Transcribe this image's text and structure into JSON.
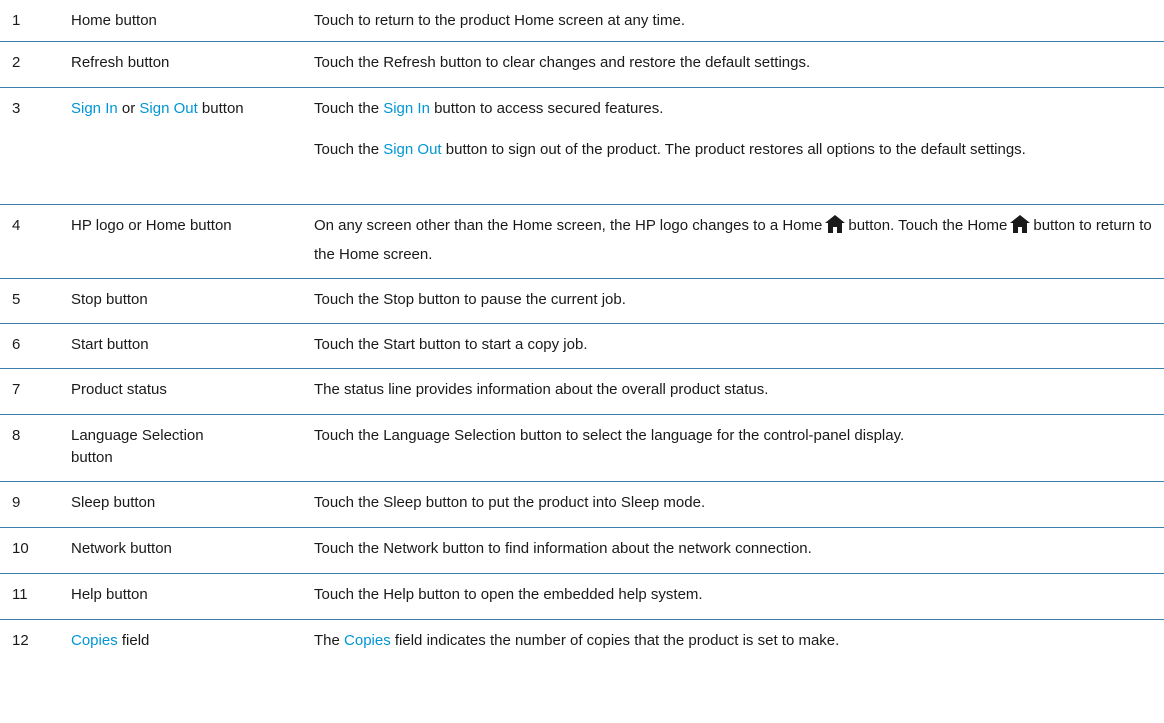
{
  "rows": [
    {
      "num": "1",
      "item": "Home button",
      "desc": "Touch to return to the product Home screen at any time."
    },
    {
      "num": "2",
      "item": "Refresh button",
      "desc": "Touch the Refresh button to clear changes and restore the default settings."
    },
    {
      "num": "3",
      "item_link_a": "Sign In",
      "item_or": " or ",
      "item_link_b": "Sign Out",
      "item_tail": " button",
      "desc1_pre": "Touch the ",
      "desc1_link": "Sign In",
      "desc1_post": " button to access secured features.",
      "desc2_pre": "Touch the ",
      "desc2_link": "Sign Out",
      "desc2_post": " button to sign out of the product. The product restores all options to the default settings."
    },
    {
      "num": "4",
      "item": "HP logo or Home button",
      "desc_a": "On any screen other than the Home screen, the HP logo changes to a Home",
      "desc_b": "button. Touch the Home",
      "desc_c": "button to return to the Home screen.",
      "icon": "home-icon"
    },
    {
      "num": "5",
      "item": "Stop button",
      "desc": "Touch the Stop button to pause the current job."
    },
    {
      "num": "6",
      "item": "Start button",
      "desc": "Touch the Start button to start a copy job."
    },
    {
      "num": "7",
      "item": "Product status",
      "desc": "The status line provides information about the overall product status."
    },
    {
      "num": "8",
      "item": "Language Selection button",
      "desc": "Touch the Language Selection button to select the language for the control-panel display."
    },
    {
      "num": "9",
      "item": "Sleep button",
      "desc": "Touch the Sleep button to put the product into Sleep mode."
    },
    {
      "num": "10",
      "item": "Network button",
      "desc": "Touch the Network button to find information about the network connection."
    },
    {
      "num": "11",
      "item": "Help button",
      "desc": "Touch the Help button to open the embedded help system."
    },
    {
      "num": "12",
      "item_link": "Copies",
      "item_tail": " field",
      "desc_pre": "The ",
      "desc_link": "Copies",
      "desc_post": " field indicates the number of copies that the product is set to make."
    }
  ],
  "colors": {
    "link": "#0096d6",
    "rule": "#3a7fae",
    "text": "#1a1a1a"
  }
}
